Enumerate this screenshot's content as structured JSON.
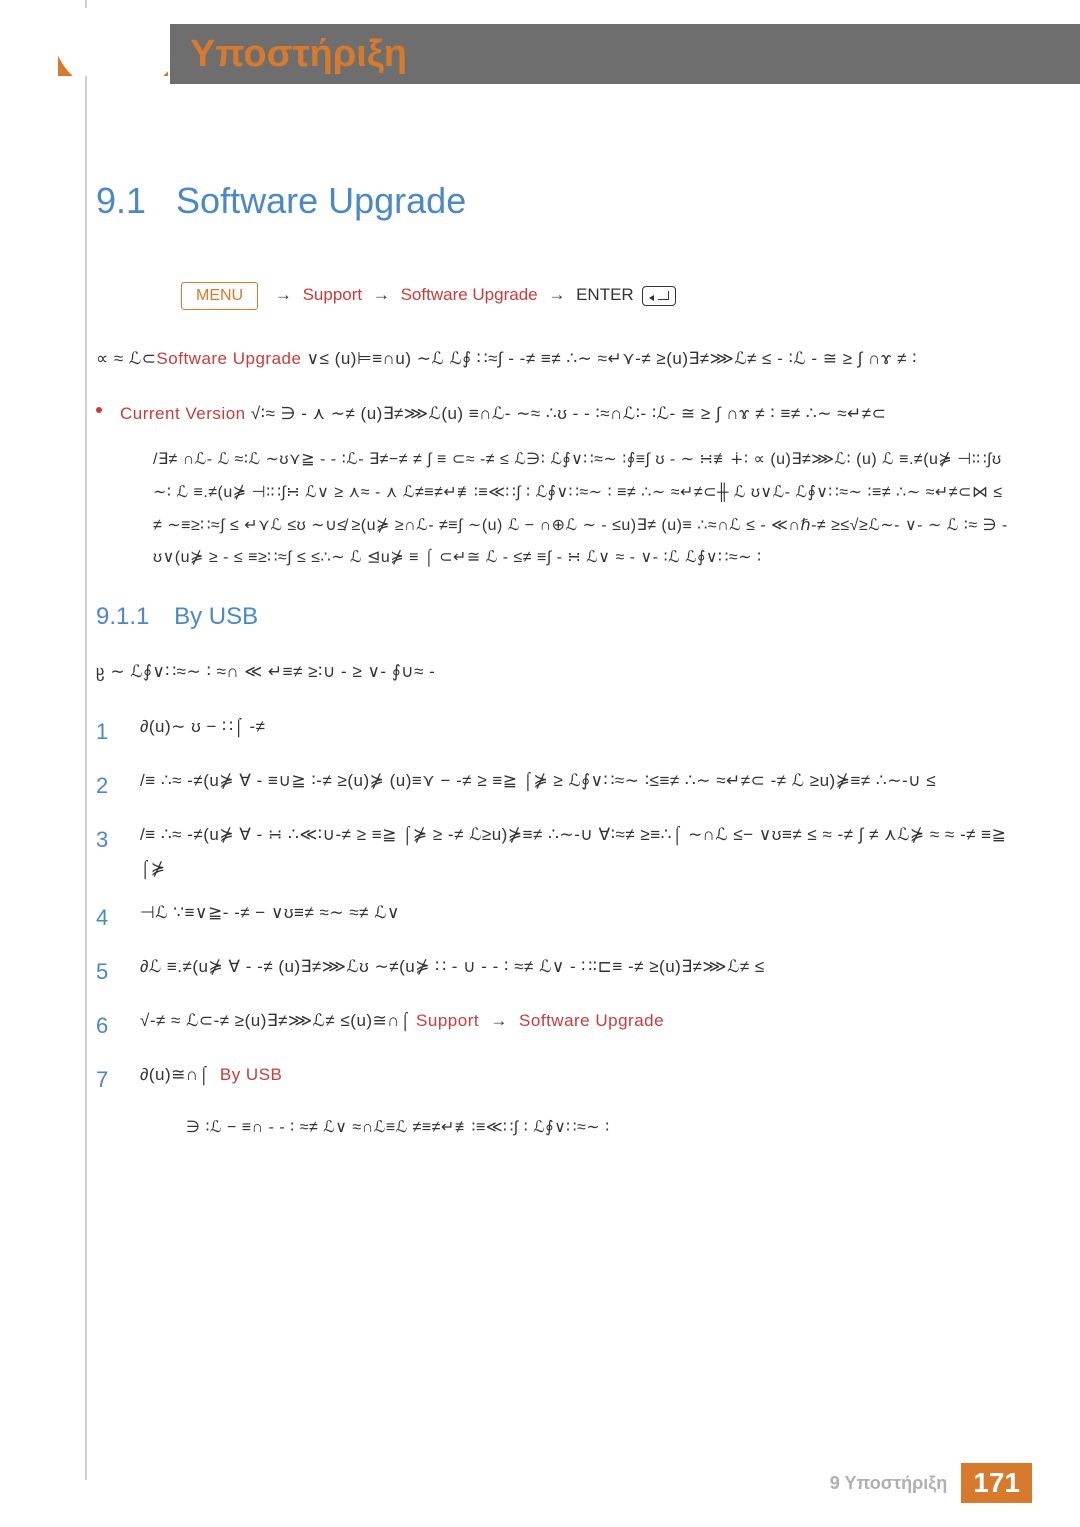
{
  "chapter": {
    "title": "Υποστήριξη"
  },
  "section": {
    "number": "9.1",
    "title": "Software Upgrade"
  },
  "menu_path": {
    "menu_label": "MENU",
    "arrow": "→",
    "items": [
      "Support",
      "Software Upgrade",
      "ENTER"
    ]
  },
  "intro_para": {
    "pre": "∝ ≈ ℒ⊂",
    "highlight": "Software Upgrade",
    "post": " ∨≤ (u)⊨≡∩u) ∼ℒ  ℒ∮  ∷≈∫  - -≠ ≡≠ ∴∼ ≈↵⋎-≠ ≥(u)∃≠⋙ℒ≠ ≤  - ∶ℒ - ≅ ≥ ∫ ∩ɤ ≠ ∶"
  },
  "bullet": {
    "label": "Current Version",
    "rest": " √∶≈ ∋ -  ⋏ ∼≠ (u)∃≠⋙ℒ(u) ≡∩ℒ- ∼≈  ∴ʊ -  - ∶≈∩ℒ∶- ∶ℒ- ≅ ≥ ∫ ∩ɤ ≠ ∶ ≡≠ ∴∼ ≈↵≠⊂"
  },
  "sub_block": "/∃≠ ∩ℒ- ℒ ≈∶ℒ ∼ʊ⋎≧ -  - ∶ℒ- ∃≠−≠ ≠ ∫ ≡ ⊂≈ -≠ ≤ ℒ∋∶  ℒ∮∨∷≈∼ ∶∮≡∫ ʊ -  ∼  ∺≢∔∶ ∝ (u)∃≠⋙ℒ∶ (u) ℒ ≡.≠(u⋡ ⊣∶∷∫ʊ ∼∶  ℒ ≡.≠(u⋡ ⊣∶∷∫∺ ℒ∨ ≥ ⋏≈ -  ⋏ ℒ≠≡≠↵≢∶≡≪∷∫ ∶  ℒ∮∨∷≈∼ ∶ ≡≠ ∴∼ ≈↵≠⊂╫  ℒ ʊ∨ℒ-   ℒ∮∨∷≈∼ ∶≡≠ ∴∼ ≈↵≠⊂⋈ ≤ ≠ ∼≡≥∷≈∫  ≤ ↵⋎ℒ ≤ʊ ∼∪≰ ≥(u⋡ ≥∩ℒ- ≠≡∫ ∼(u) ℒ − ∩⊕ℒ  ∼ - ≤u)∃≠ (u)≡ ∴≈∩ℒ ≤ - ≪∩ℏ-≠ ≥≤√≥ℒ∼- ∨-  ∼ ℒ  ∶≈ ∋ -  ʊ∨(u⋡ ≥ - ≤ ≡≥∷≈∫  ≤  ≤∴∼ ℒ ⊴u⋡ ≡ ⌠  ⊂↵≅  ℒ - ≤≠ ≡∫  -  ∺ ℒ∨ ≈ - ∨- ∶ℒ ℒ∮∨∷≈∼ ∶",
  "subsection": {
    "number": "9.1.1",
    "title": "By USB"
  },
  "subsec_intro": "ჸ ∼  ℒ∮∨∷≈∼ ∶ ≈∩ ≪        ↵≡≠ ≥∶∪ -  ≥ ∨-  ∮∪≈ -",
  "steps": [
    "∂(u)∼ ʊ − ∷⌠ -≠",
    "/≡ ∴≈ -≠(u⋡ ∀ -  ≡∪≧ ∶-≠ ≥(u)⋡ (u)≡⋎ −  -≠ ≥  ≡≧ ⌠⋡ ≥       ℒ∮∨∷≈∼ ∶≤≡≠ ∴∼ ≈↵≠⊂ -≠ ℒ ≥u)⋡≡≠ ∴∼-∪   ≤",
    "/≡ ∴≈ -≠(u⋡ ∀ -  ∺ ∴≪∶∪-≠ ≥  ≡≧ ⌠⋡ ≥     -≠ ℒ≥u)⋡≡≠ ∴∼-∪ ∀∶≈≠ ≥≡∴⌠ ∼∩ℒ ≤− ∨ʊ≡≠ ≤ ≈ -≠ ∫ ≠ ⋏ℒ⋡ ≈  ≈ -≠  ≡≧ ⌠⋡",
    "⊣ℒ ∵≡∨≧-  -≠ − ∨ʊ≡≠    ≈∼  ≈≠ ℒ∨",
    "∂ℒ ≡.≠(u⋡ ∀ -  -≠ (u)∃≠⋙ℒʊ ∼≠(u⋡ ∷ - ∪ -  - ∶ ≈≠ ℒ∨           - ∷∶⊏≡    -≠ ≥(u)∃≠⋙ℒ≠ ≤",
    "√-≠ ≈ ℒ⊂-≠ ≥(u)∃≠⋙ℒ≠ ≤(u)≅∩⌠",
    "∂(u)≅∩⌠"
  ],
  "step6_path": [
    "Support",
    "Software Upgrade"
  ],
  "step7_highlight": "By USB",
  "after_list": "∋ ∶ℒ −  ≡∩ - - ∶ ≈≠ ℒ∨       ≈∩ℒ≡ℒ ≠≡≠↵≢∶≡≪∷∫ ∶  ℒ∮∨∷≈∼ ∶",
  "footer": {
    "chapter_num": "9",
    "chapter_label": "Υποστήριξη",
    "page": "171"
  }
}
